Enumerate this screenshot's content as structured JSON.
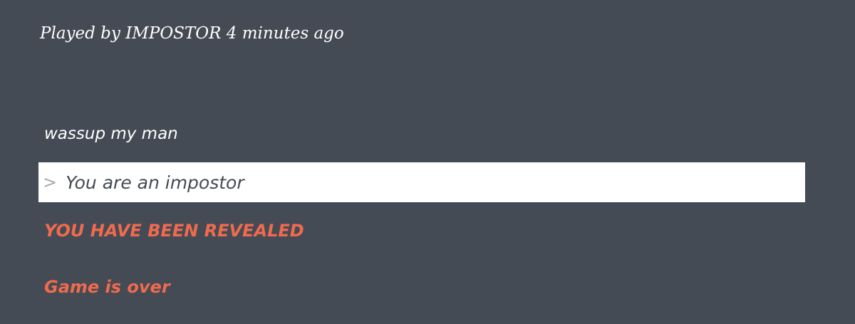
{
  "header": {
    "played_by": "Played by IMPOSTOR 4 minutes ago"
  },
  "log": {
    "message": "wassup my man",
    "prompt_symbol": ">",
    "command": "You are an impostor",
    "revealed": "YOU HAVE BEEN REVEALED",
    "game_over": "Game is over"
  },
  "colors": {
    "background": "#444b55",
    "alert": "#f06a4e"
  }
}
